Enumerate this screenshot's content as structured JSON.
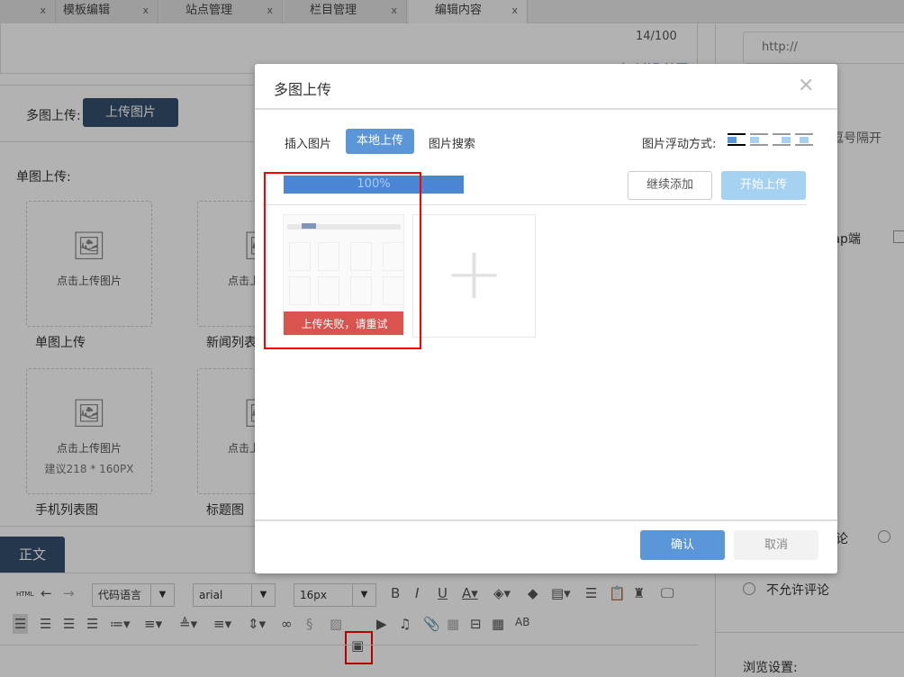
{
  "tabs": [
    {
      "label": "",
      "close": "x"
    },
    {
      "label": "模板编辑",
      "close": "x"
    },
    {
      "label": "站点管理",
      "close": "x"
    },
    {
      "label": "栏目管理",
      "close": "x"
    },
    {
      "label": "编辑内容",
      "close": "x",
      "active": true
    }
  ],
  "main": {
    "counter": "14/100",
    "auto_summary": "自动获取摘要",
    "multi_upload_label": "多图上传:",
    "multi_upload_button": "上传图片",
    "single_upload_label": "单图上传:",
    "cards": [
      {
        "text": "点击上传图片",
        "hint": "",
        "caption": "单图上传"
      },
      {
        "text": "点击上传图片",
        "hint": "",
        "caption": "新闻列表图"
      },
      {
        "text": "点击上传图片",
        "hint": "建议218 * 160PX",
        "caption": "手机列表图"
      },
      {
        "text": "点击上传图片",
        "hint": "",
        "caption": "标题图"
      }
    ],
    "editor_tab": "正文",
    "toolbar": {
      "code_lang": "代码语言",
      "font": "arial",
      "size": "16px",
      "html": "HTML"
    }
  },
  "right": {
    "url_placeholder": "http://",
    "comma_hint": "逗号隔开",
    "wap_label": "wap端",
    "comment_option": "论",
    "no_comment": "不允许评论",
    "browse_settings": "浏览设置:"
  },
  "modal": {
    "title": "多图上传",
    "close": "✕",
    "tabs": [
      "插入图片",
      "本地上传",
      "图片搜索"
    ],
    "active_tab": 1,
    "float_label": "图片浮动方式:",
    "progress_text": "100%",
    "progress": 100,
    "continue_add": "继续添加",
    "start_upload": "开始上传",
    "error_text": "上传失败，请重试",
    "add_icon": "+",
    "confirm": "确认",
    "cancel": "取消"
  },
  "colors": {
    "primary": "#5b97d8",
    "dark_button": "#34506f",
    "error": "#d9534f",
    "highlight": "#ff0000",
    "progress": "#4a86d4"
  }
}
